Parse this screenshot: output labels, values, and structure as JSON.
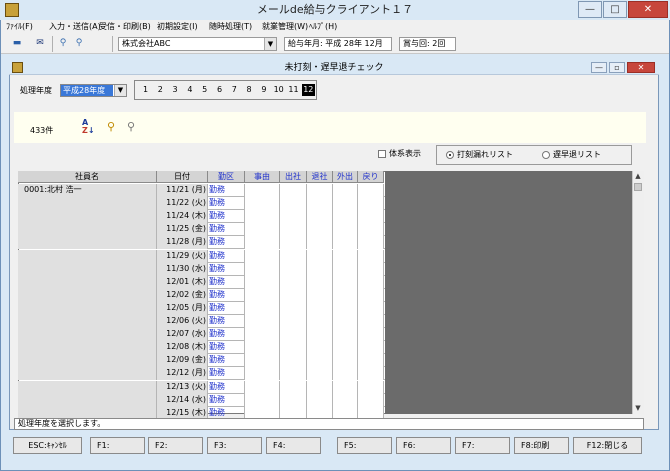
{
  "app": {
    "title": "メールde給与クライアント１７"
  },
  "menu": [
    "ﾌｧｲﾙ(F)",
    "入力・送信(A)",
    "受信・印刷(B)",
    "初期設定(I)",
    "随時処理(T)",
    "就業管理(W)",
    "ﾍﾙﾌﾟ(H)"
  ],
  "toolbar": {
    "company": "株式会社ABC",
    "pay_month_label": "給与年月:",
    "pay_month": "平成 28年 12月",
    "bonus_label": "賞与回:",
    "bonus": "2回"
  },
  "child": {
    "title": "未打刻・遅早退チェック"
  },
  "filter": {
    "year_label": "処理年度",
    "year": "平成28年度",
    "months": [
      "1",
      "2",
      "3",
      "4",
      "5",
      "6",
      "7",
      "8",
      "9",
      "10",
      "11",
      "12"
    ],
    "selected_month": "12"
  },
  "info": {
    "count": "433件"
  },
  "options": {
    "hierarchy_label": "体系表示",
    "radio1": "打刻漏れリスト",
    "radio2": "遅早退リスト"
  },
  "table": {
    "headers": [
      "社員名",
      "日付",
      "勤区",
      "事由",
      "出社",
      "退社",
      "外出",
      "戻り"
    ],
    "rows": [
      {
        "name": "0001:北村 浩一",
        "date": "11/21 (月)",
        "kubun": "勤務"
      },
      {
        "name": "",
        "date": "11/22 (火)",
        "kubun": "勤務"
      },
      {
        "name": "",
        "date": "11/24 (木)",
        "kubun": "勤務"
      },
      {
        "name": "",
        "date": "11/25 (金)",
        "kubun": "勤務"
      },
      {
        "name": "",
        "date": "11/28 (月)",
        "kubun": "勤務"
      },
      {
        "name": "",
        "date": "11/29 (火)",
        "kubun": "勤務"
      },
      {
        "name": "",
        "date": "11/30 (水)",
        "kubun": "勤務"
      },
      {
        "name": "",
        "date": "12/01 (木)",
        "kubun": "勤務"
      },
      {
        "name": "",
        "date": "12/02 (金)",
        "kubun": "勤務"
      },
      {
        "name": "",
        "date": "12/05 (月)",
        "kubun": "勤務"
      },
      {
        "name": "",
        "date": "12/06 (火)",
        "kubun": "勤務"
      },
      {
        "name": "",
        "date": "12/07 (水)",
        "kubun": "勤務"
      },
      {
        "name": "",
        "date": "12/08 (木)",
        "kubun": "勤務"
      },
      {
        "name": "",
        "date": "12/09 (金)",
        "kubun": "勤務"
      },
      {
        "name": "",
        "date": "12/12 (月)",
        "kubun": "勤務"
      },
      {
        "name": "",
        "date": "12/13 (火)",
        "kubun": "勤務"
      },
      {
        "name": "",
        "date": "12/14 (水)",
        "kubun": "勤務"
      },
      {
        "name": "",
        "date": "12/15 (木)",
        "kubun": "勤務"
      }
    ]
  },
  "status": {
    "message": "処理年度を選択します。"
  },
  "fkeys": [
    "ESC:ｷｬﾝｾﾙ",
    "F1:",
    "F2:",
    "F3:",
    "F4:",
    "F5:",
    "F6:",
    "F7:",
    "F8:印刷",
    "F12:閉じる"
  ],
  "colors": {
    "accent": "#3a78d8",
    "link_blue": "#2233cc",
    "grid_gray": "#6b6b6b"
  }
}
